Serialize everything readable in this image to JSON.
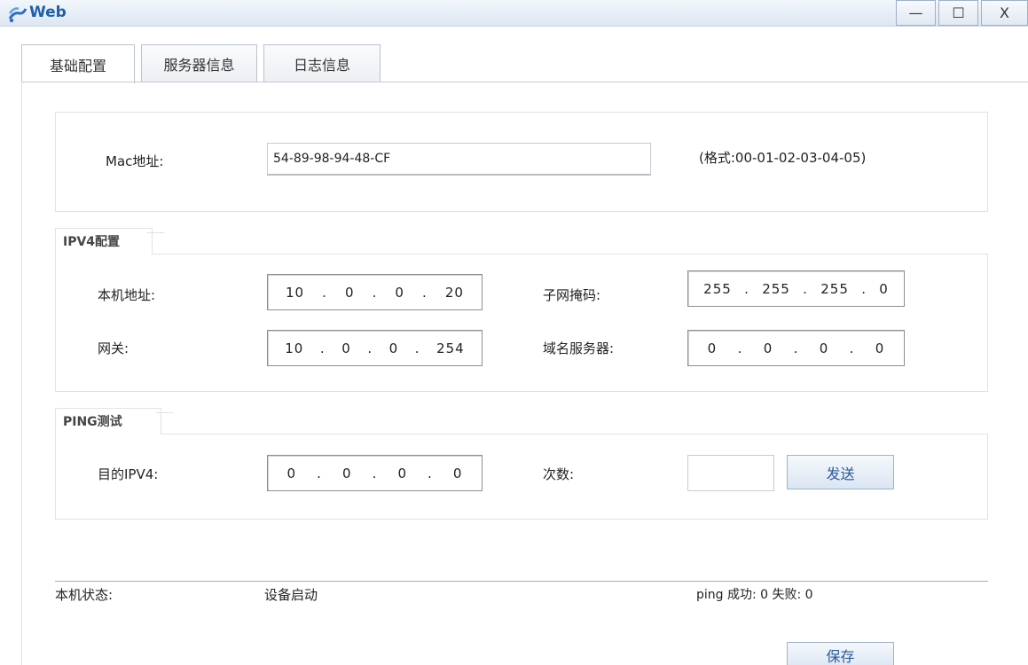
{
  "window": {
    "title": "Web",
    "minimize": "—",
    "maximize": "☐",
    "close": "X",
    "icon": "app-logo-icon"
  },
  "tabs": [
    "基础配置",
    "服务器信息",
    "日志信息"
  ],
  "mac": {
    "label": "Mac地址:",
    "value": "54-89-98-94-48-CF",
    "hint": "(格式:00-01-02-03-04-05)"
  },
  "ipv4": {
    "legend": "IPV4配置",
    "host_label": "本机地址:",
    "host": [
      "10",
      ".",
      "0",
      ".",
      "0",
      ".",
      "20"
    ],
    "mask_label": "子网掩码:",
    "mask": [
      "255",
      ".",
      "255",
      ".",
      "255",
      ".",
      "0"
    ],
    "gateway_label": "网关:",
    "gateway": [
      "10",
      ".",
      "0",
      ".",
      "0",
      ".",
      "254"
    ],
    "dns_label": "域名服务器:",
    "dns": [
      "0",
      ".",
      "0",
      ".",
      "0",
      ".",
      "0"
    ]
  },
  "ping": {
    "legend": "PING测试",
    "dest_label": "目的IPV4:",
    "dest": [
      "0",
      ".",
      "0",
      ".",
      "0",
      ".",
      "0"
    ],
    "count_label": "次数:",
    "count_value": "",
    "send_label": "发送"
  },
  "status": {
    "label": "本机状态:",
    "value": "设备启动",
    "ping_result": "ping 成功: 0 失败: 0"
  },
  "save_label": "保存"
}
